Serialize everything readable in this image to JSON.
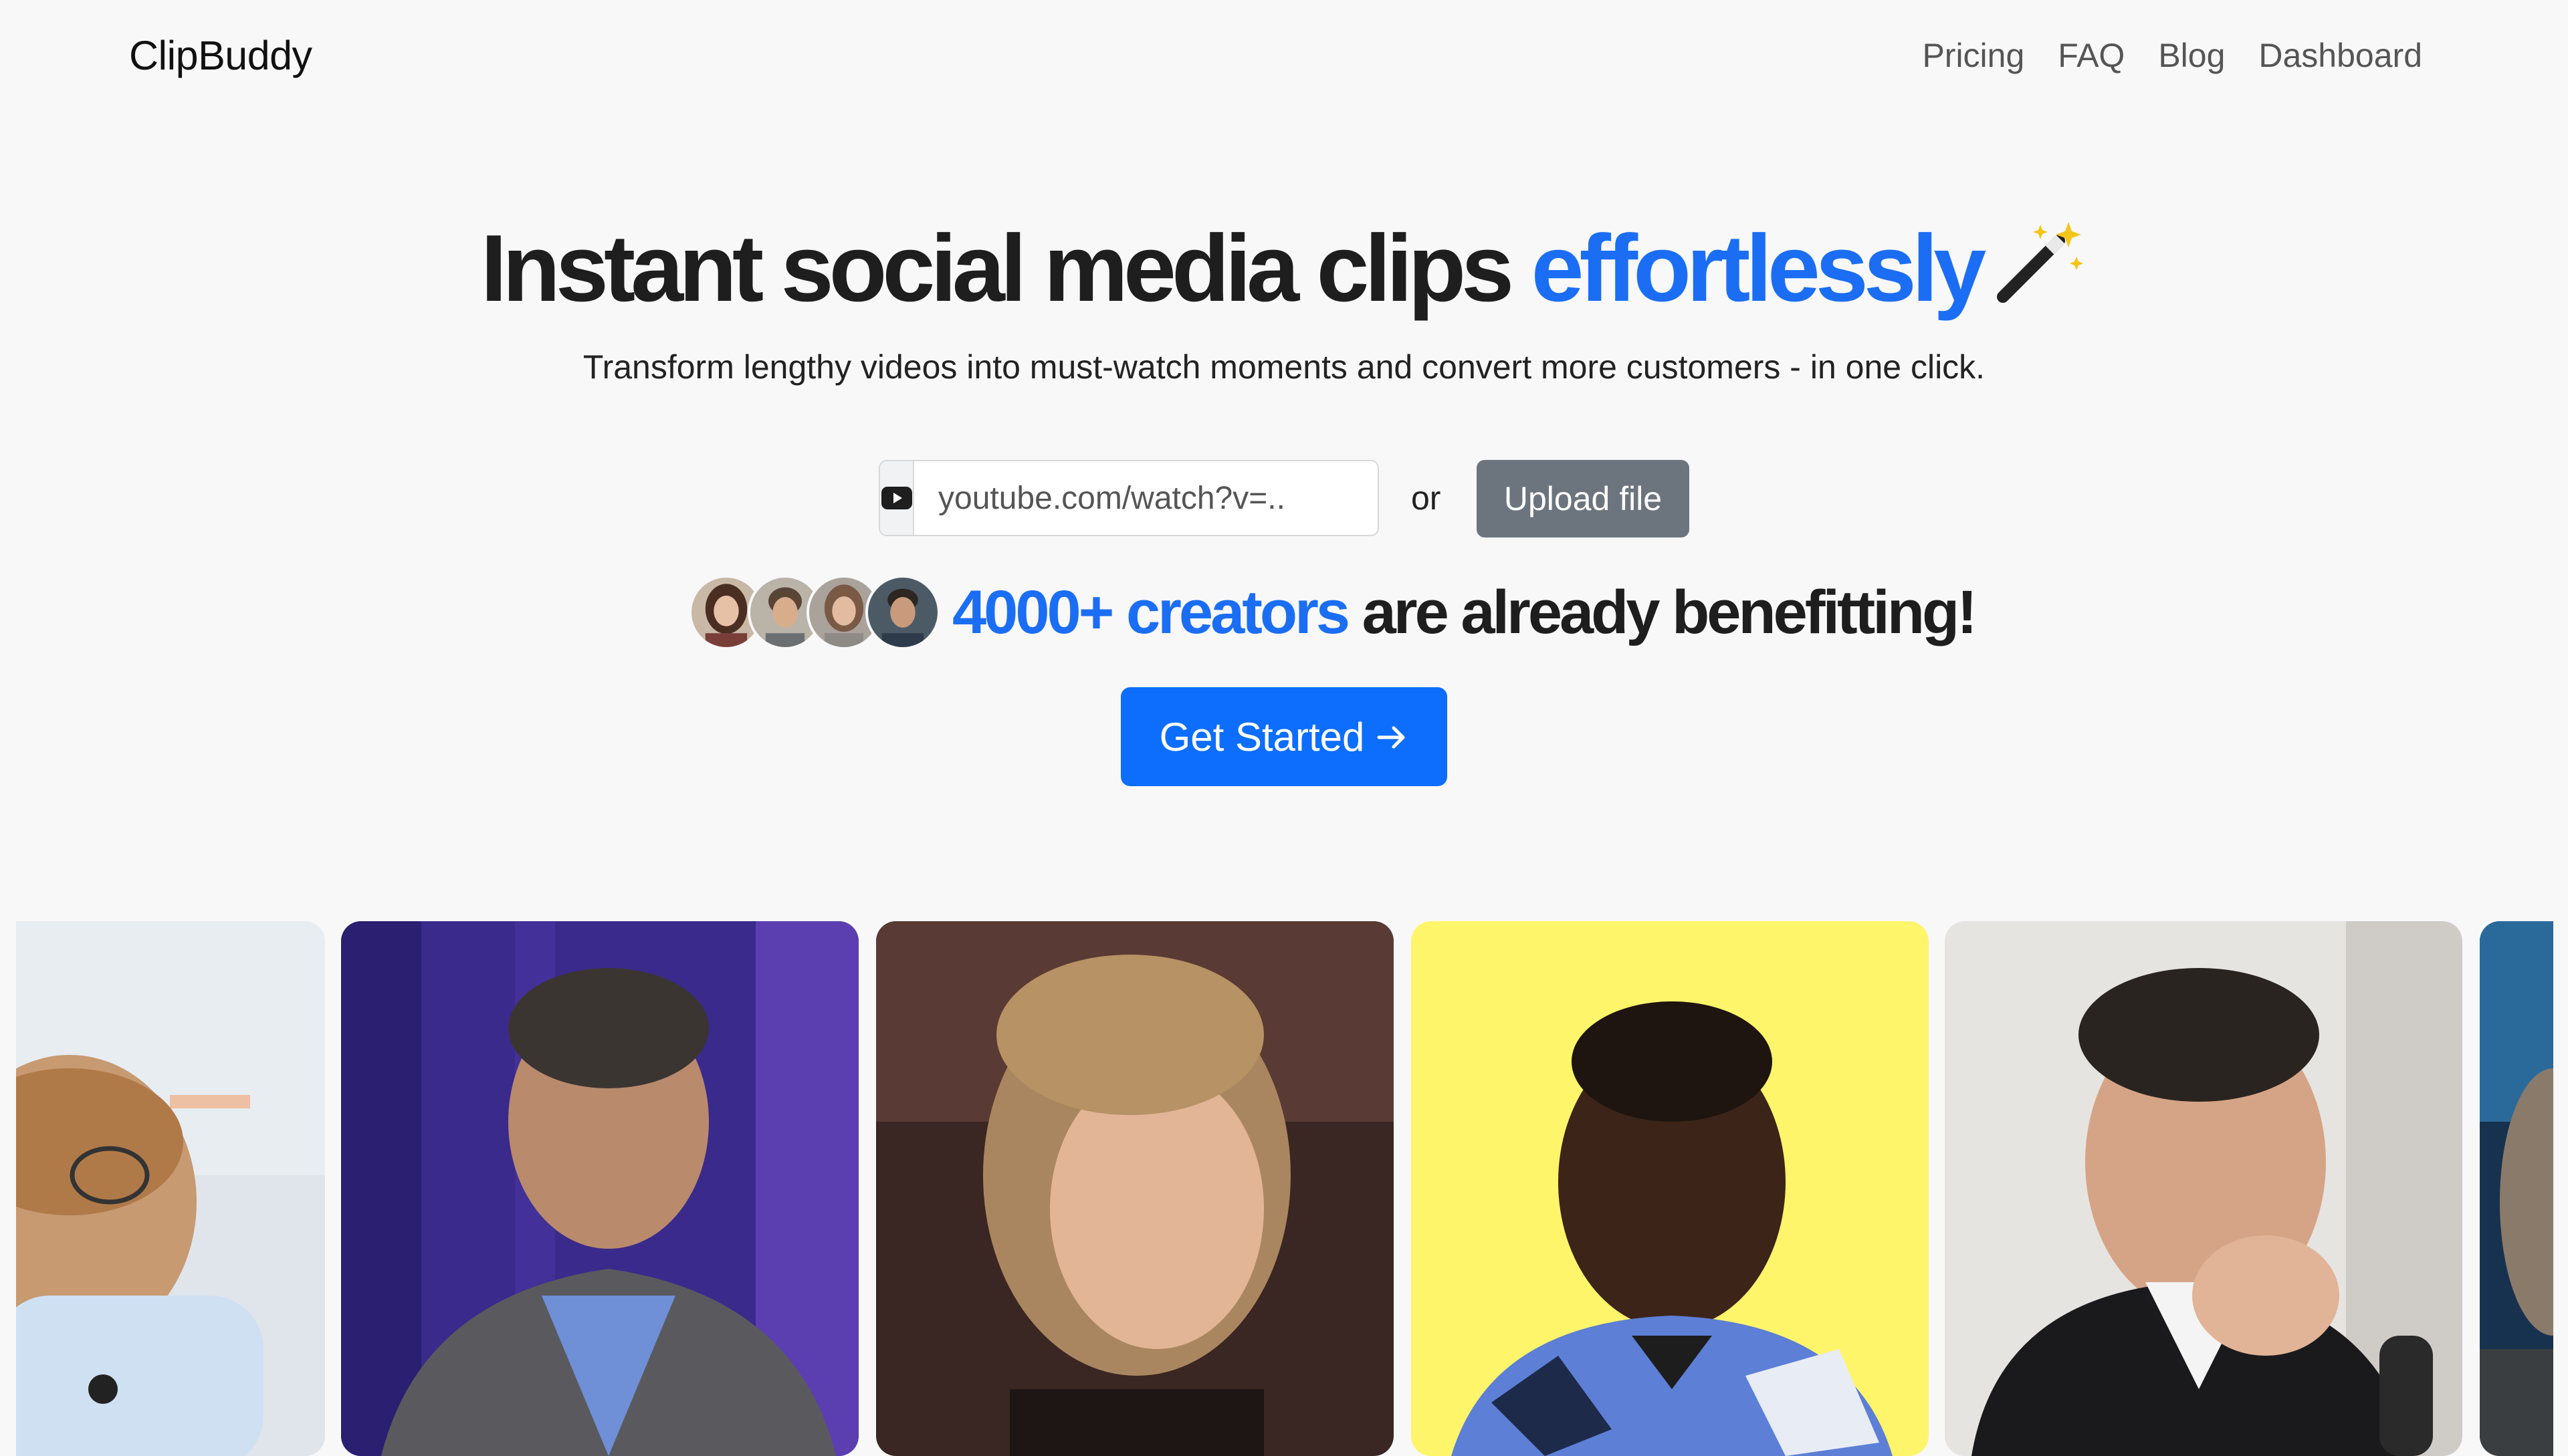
{
  "nav": {
    "brand": "ClipBuddy",
    "links": [
      "Pricing",
      "FAQ",
      "Blog",
      "Dashboard"
    ]
  },
  "hero": {
    "title_main": "Instant social media clips",
    "title_accent": "effortlessly",
    "title_icon": "magic-wand-icon",
    "subtitle": "Transform lengthy videos into must-watch moments and convert more customers - in one click."
  },
  "input": {
    "icon": "youtube-icon",
    "placeholder": "youtube.com/watch?v=..",
    "or_label": "or",
    "upload_label": "Upload file"
  },
  "social_proof": {
    "count_accent": "4000+ creators",
    "rest": "are already benefitting!"
  },
  "cta": {
    "label": "Get Started",
    "icon": "arrow-right-icon"
  },
  "colors": {
    "accent": "#1b6ef3",
    "primary_button": "#0d6efd",
    "secondary_button": "#6c757d",
    "background": "#f8f8f9"
  }
}
